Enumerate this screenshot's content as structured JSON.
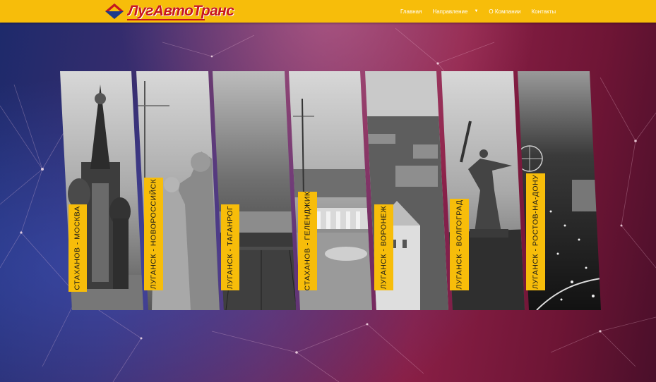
{
  "brand": {
    "name": "ЛугАвтоТранс"
  },
  "nav": {
    "items": [
      {
        "label": "Главная"
      },
      {
        "label": "Направление",
        "has_dropdown": true
      },
      {
        "label": "О Компании"
      },
      {
        "label": "Контакты"
      }
    ]
  },
  "routes": [
    {
      "label": "СТАХАНОВ - МОСКВА",
      "photo": "moscow-cathedral"
    },
    {
      "label": "ЛУГАНСК - НОВОРОССИЙСК",
      "photo": "novorossiysk-statue"
    },
    {
      "label": "ЛУГАНСК - ТАГАНРОГ",
      "photo": "taganrog-embankment"
    },
    {
      "label": "СТАХАНОВ - ГЕЛЕНДЖИК",
      "photo": "gelendzhik-sailing-ship"
    },
    {
      "label": "ЛУГАНСК - ВОРОНЕЖ",
      "photo": "voronezh-city"
    },
    {
      "label": "ЛУГАНСК - ВОЛГОГРАД",
      "photo": "volgograd-motherland-statue"
    },
    {
      "label": "ЛУГАНСК - РОСТОВ-НА-ДОНУ",
      "photo": "rostov-night-city"
    }
  ],
  "colors": {
    "accent": "#f7bd0a",
    "brand_red": "#c8161d"
  }
}
